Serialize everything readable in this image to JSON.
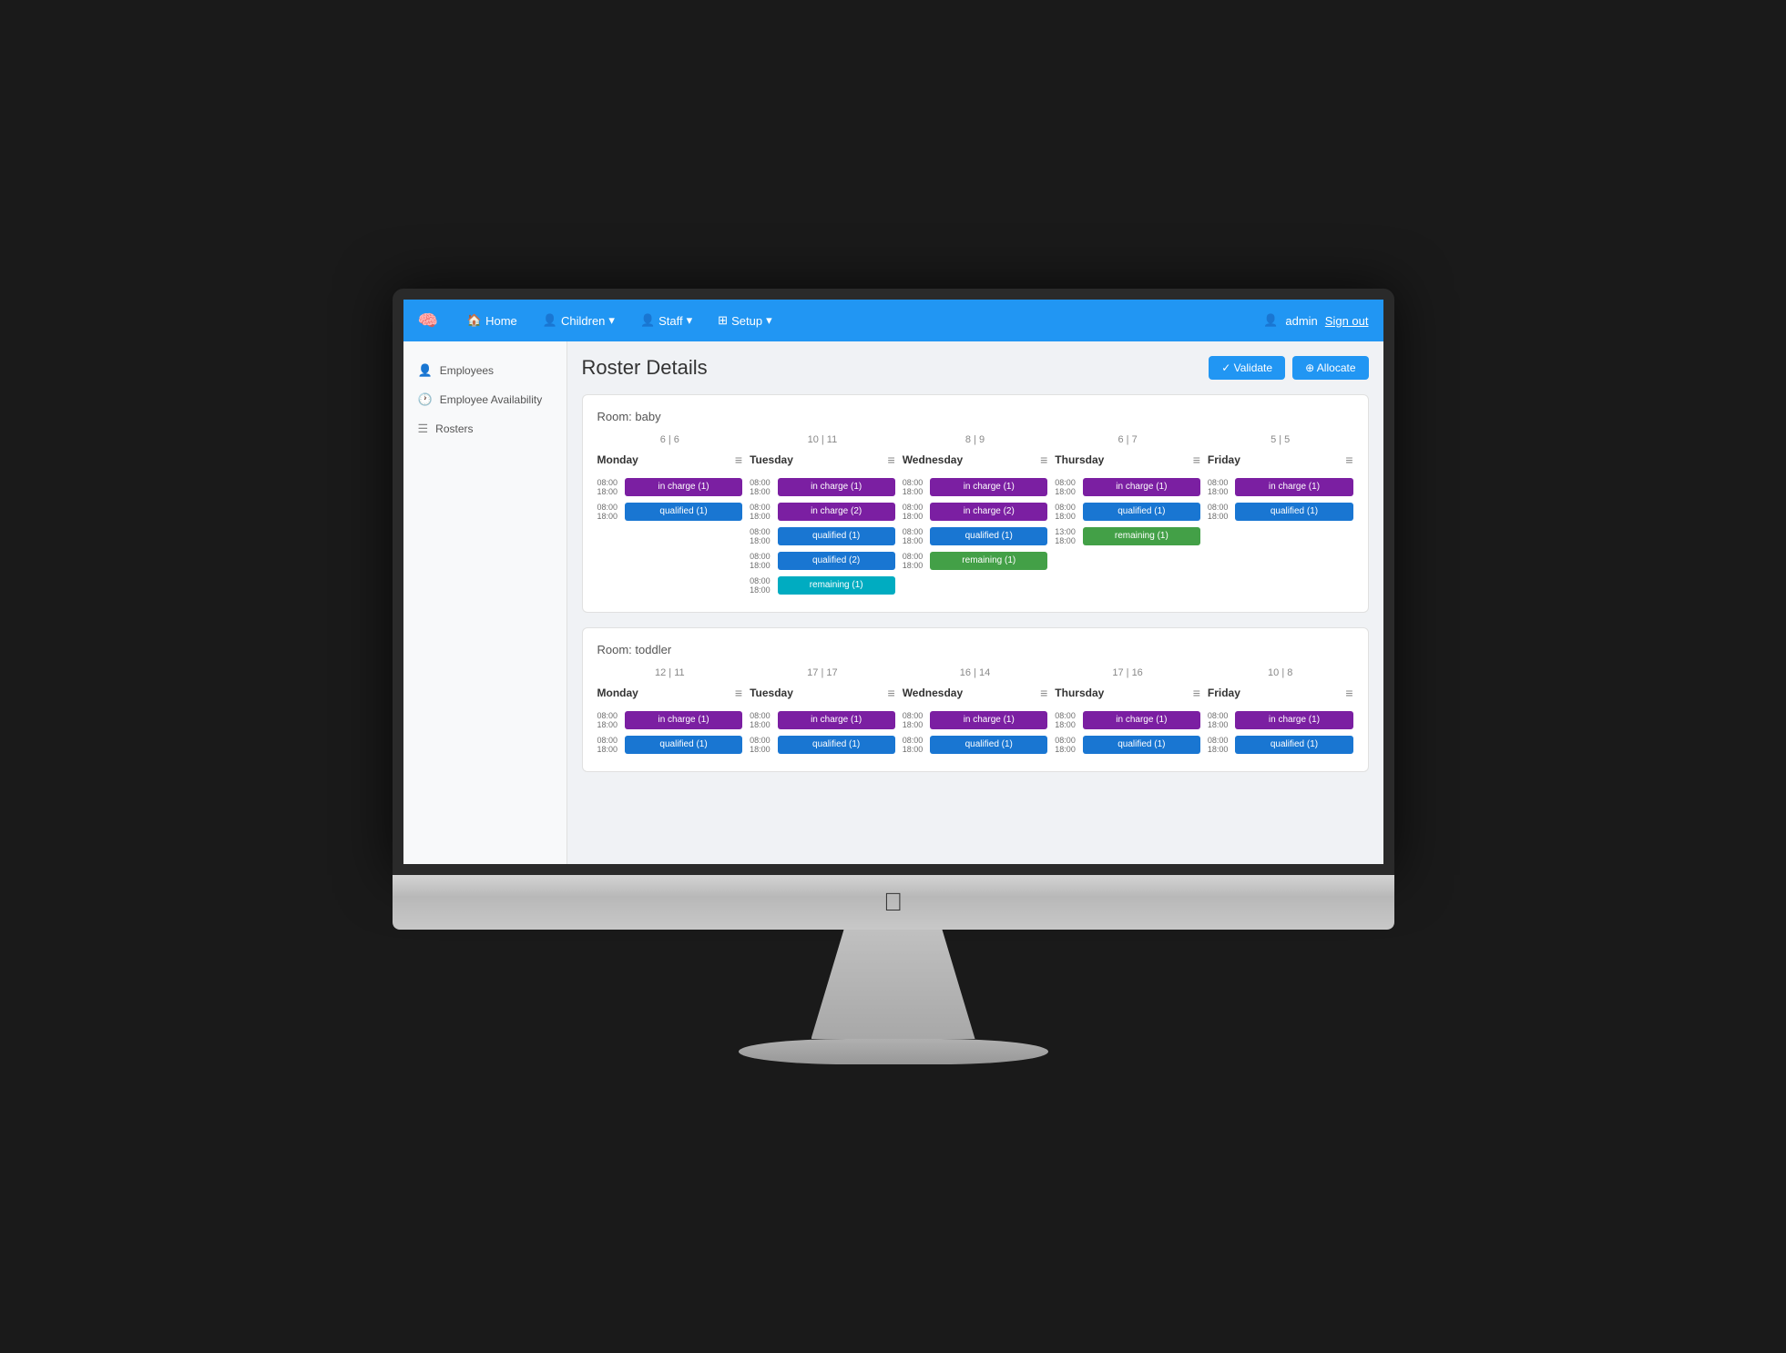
{
  "navbar": {
    "brand_icon": "🧠",
    "home_label": "Home",
    "children_label": "Children",
    "staff_label": "Staff",
    "setup_label": "Setup",
    "admin_label": "admin",
    "signout_label": "Sign out"
  },
  "sidebar": {
    "employees_label": "Employees",
    "availability_label": "Employee Availability",
    "rosters_label": "Rosters"
  },
  "page": {
    "title": "Roster Details",
    "validate_label": "✓ Validate",
    "allocate_label": "⊕ Allocate"
  },
  "rooms": [
    {
      "name": "Room: baby",
      "days": [
        {
          "stats": "6 | 6",
          "name": "Monday",
          "shifts": [
            {
              "time_start": "08:00",
              "time_end": "18:00",
              "label": "in charge (1)",
              "color": "purple"
            },
            {
              "time_start": "08:00",
              "time_end": "18:00",
              "label": "qualified (1)",
              "color": "blue"
            },
            null,
            null,
            null
          ]
        },
        {
          "stats": "10 | 11",
          "name": "Tuesday",
          "shifts": [
            {
              "time_start": "08:00",
              "time_end": "18:00",
              "label": "in charge (1)",
              "color": "purple"
            },
            {
              "time_start": "08:00",
              "time_end": "18:00",
              "label": "in charge (2)",
              "color": "purple"
            },
            {
              "time_start": "08:00",
              "time_end": "18:00",
              "label": "qualified (1)",
              "color": "blue"
            },
            {
              "time_start": "08:00",
              "time_end": "18:00",
              "label": "qualified (2)",
              "color": "blue"
            },
            {
              "time_start": "08:00",
              "time_end": "18:00",
              "label": "remaining (1)",
              "color": "teal"
            }
          ]
        },
        {
          "stats": "8 | 9",
          "name": "Wednesday",
          "shifts": [
            {
              "time_start": "08:00",
              "time_end": "18:00",
              "label": "in charge (1)",
              "color": "purple"
            },
            {
              "time_start": "08:00",
              "time_end": "18:00",
              "label": "in charge (2)",
              "color": "purple"
            },
            {
              "time_start": "08:00",
              "time_end": "18:00",
              "label": "qualified (1)",
              "color": "blue"
            },
            {
              "time_start": "08:00",
              "time_end": "18:00",
              "label": "remaining (1)",
              "color": "green"
            },
            null
          ]
        },
        {
          "stats": "6 | 7",
          "name": "Thursday",
          "shifts": [
            {
              "time_start": "08:00",
              "time_end": "18:00",
              "label": "in charge (1)",
              "color": "purple"
            },
            {
              "time_start": "08:00",
              "time_end": "18:00",
              "label": "qualified (1)",
              "color": "blue"
            },
            {
              "time_start": "13:00",
              "time_end": "18:00",
              "label": "remaining (1)",
              "color": "green"
            },
            null,
            null
          ]
        },
        {
          "stats": "5 | 5",
          "name": "Friday",
          "shifts": [
            {
              "time_start": "08:00",
              "time_end": "18:00",
              "label": "in charge (1)",
              "color": "purple"
            },
            {
              "time_start": "08:00",
              "time_end": "18:00",
              "label": "qualified (1)",
              "color": "blue"
            },
            null,
            null,
            null
          ]
        }
      ]
    },
    {
      "name": "Room: toddler",
      "days": [
        {
          "stats": "12 | 11",
          "name": "Monday",
          "shifts": [
            {
              "time_start": "08:00",
              "time_end": "18:00",
              "label": "in charge (1)",
              "color": "purple"
            },
            {
              "time_start": "08:00",
              "time_end": "18:00",
              "label": "qualified (1)",
              "color": "blue"
            }
          ]
        },
        {
          "stats": "17 | 17",
          "name": "Tuesday",
          "shifts": [
            {
              "time_start": "08:00",
              "time_end": "18:00",
              "label": "in charge (1)",
              "color": "purple"
            },
            {
              "time_start": "08:00",
              "time_end": "18:00",
              "label": "qualified (1)",
              "color": "blue"
            }
          ]
        },
        {
          "stats": "16 | 14",
          "name": "Wednesday",
          "shifts": [
            {
              "time_start": "08:00",
              "time_end": "18:00",
              "label": "in charge (1)",
              "color": "purple"
            },
            {
              "time_start": "08:00",
              "time_end": "18:00",
              "label": "qualified (1)",
              "color": "blue"
            }
          ]
        },
        {
          "stats": "17 | 16",
          "name": "Thursday",
          "shifts": [
            {
              "time_start": "08:00",
              "time_end": "18:00",
              "label": "in charge (1)",
              "color": "purple"
            },
            {
              "time_start": "08:00",
              "time_end": "18:00",
              "label": "qualified (1)",
              "color": "blue"
            }
          ]
        },
        {
          "stats": "10 | 8",
          "name": "Friday",
          "shifts": [
            {
              "time_start": "08:00",
              "time_end": "18:00",
              "label": "in charge (1)",
              "color": "purple"
            },
            {
              "time_start": "08:00",
              "time_end": "18:00",
              "label": "qualified (1)",
              "color": "blue"
            }
          ]
        }
      ]
    }
  ]
}
